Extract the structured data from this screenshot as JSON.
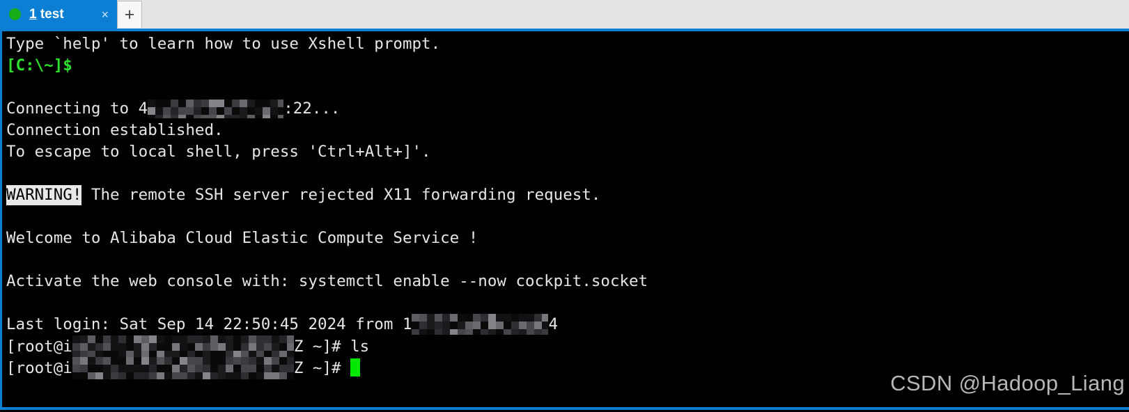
{
  "window": {
    "accent_color": "#0b7fd4",
    "tabbar_bg": "#e4e4e4",
    "terminal_bg": "#000000",
    "terminal_fg": "#e6e6e6",
    "prompt_green": "#2ee02e",
    "cursor_color": "#00e800"
  },
  "tabbar": {
    "active_tab": {
      "index": "1",
      "title": "test",
      "status_icon": "green-dot-icon",
      "close_label": "×"
    },
    "new_tab_label": "+"
  },
  "terminal": {
    "lines": [
      {
        "id": "help-hint",
        "text": "Type `help' to learn how to use Xshell prompt."
      },
      {
        "id": "local-prompt",
        "text": "[C:\\~]$",
        "style": "green"
      },
      {
        "id": "blank-1",
        "text": ""
      },
      {
        "id": "connecting",
        "prefix": "Connecting to 4",
        "redacted": true,
        "suffix": ":22..."
      },
      {
        "id": "connection-established",
        "text": "Connection established."
      },
      {
        "id": "escape-hint",
        "text": "To escape to local shell, press 'Ctrl+Alt+]'."
      },
      {
        "id": "blank-2",
        "text": ""
      },
      {
        "id": "x11-warning",
        "badge": "WARNING!",
        "text": " The remote SSH server rejected X11 forwarding request."
      },
      {
        "id": "blank-3",
        "text": ""
      },
      {
        "id": "welcome",
        "text": "Welcome to Alibaba Cloud Elastic Compute Service !"
      },
      {
        "id": "blank-4",
        "text": ""
      },
      {
        "id": "cockpit-hint",
        "text": "Activate the web console with: systemctl enable --now cockpit.socket"
      },
      {
        "id": "blank-5",
        "text": ""
      },
      {
        "id": "last-login",
        "prefix": "Last login: Sat Sep 14 22:50:45 2024 from 1",
        "redacted": true,
        "suffix": "4"
      },
      {
        "id": "command-ls",
        "prefix": "[root@i",
        "redacted": true,
        "suffix": "Z ~]# ls"
      },
      {
        "id": "prompt-active",
        "prefix": "[root@i",
        "redacted": true,
        "suffix": "Z ~]# ",
        "cursor": true
      }
    ]
  },
  "watermark": {
    "text": "CSDN @Hadoop_Liang"
  }
}
